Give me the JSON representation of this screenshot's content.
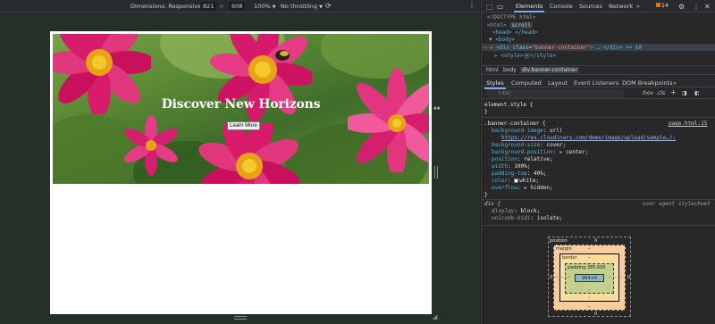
{
  "device_toolbar": {
    "dimensions_label": "Dimensions: Responsive",
    "width": "821",
    "height": "608",
    "zoom": "100%",
    "throttling": "No throttling"
  },
  "banner": {
    "title": "Discover New Horizons",
    "button_label": "Learn More"
  },
  "devtools": {
    "tabs": [
      "Elements",
      "Console",
      "Sources",
      "Network"
    ],
    "active_tab": "Elements",
    "issues_count": "14",
    "dom": {
      "doctype": "<!DOCTYPE html>",
      "html_open": "<html>",
      "html_chip": "scroll",
      "head": "<head> </head>",
      "body_open": "<body>",
      "div_selected_tag": "div",
      "div_class_attr": "class",
      "div_class_val": "\"banner-container\"",
      "div_tail": "> … </div> == $0",
      "style_tag": "<style>",
      "style_chip": "⋯",
      "style_close": "</style>"
    },
    "breadcrumbs": [
      "html",
      "body",
      "div.banner-container"
    ],
    "style_tabs": [
      "Styles",
      "Computed",
      "Layout",
      "Event Listeners",
      "DOM Breakpoints"
    ],
    "active_style_tab": "Styles",
    "filter_placeholder": "Filter",
    "filter_hov": ":hov",
    "filter_cls": ".cls",
    "rules": {
      "element_style": "element.style {",
      "close_brace": "}",
      "banner_selector": ".banner-container {",
      "banner_source": "page.html:15",
      "decls": [
        {
          "prop": "background-image",
          "val": "url("
        },
        {
          "prop": "",
          "val": "https://res.cloudinary.com/demo/image/upload/sample…);"
        },
        {
          "prop": "background-size",
          "val": "cover;"
        },
        {
          "prop": "background-position",
          "val": "▸ center;"
        },
        {
          "prop": "position",
          "val": "relative;"
        },
        {
          "prop": "width",
          "val": "100%;"
        },
        {
          "prop": "padding-top",
          "val": "40%;"
        },
        {
          "prop": "color",
          "val": "white;"
        },
        {
          "prop": "overflow",
          "val": "▸ hidden;"
        }
      ],
      "div_selector": "div {",
      "ua_label": "user agent stylesheet",
      "ua_decls": [
        {
          "prop": "display",
          "val": "block;"
        },
        {
          "prop": "unicode-bidi",
          "val": "isolate;"
        }
      ]
    },
    "box_model": {
      "position_label": "position",
      "position_val": "0",
      "margin_label": "margin",
      "margin_dash": "–",
      "border_label": "border",
      "border_dash": "–",
      "padding_label": "padding 385.600",
      "padding_dash": "–",
      "content": "964×0",
      "side_zero": "0"
    }
  },
  "colors": {
    "accent": "#7cacf8",
    "tag": "#5db0d7",
    "attr_value": "#f29766"
  }
}
